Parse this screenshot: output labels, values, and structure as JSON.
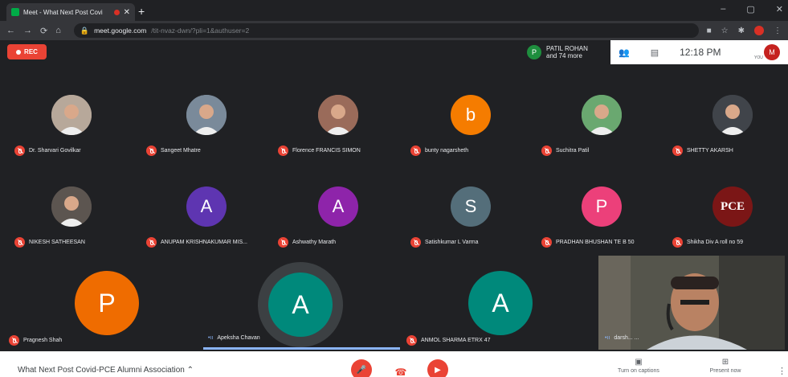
{
  "browser": {
    "tab_title": "Meet - What Next Post Covi",
    "url_host": "meet.google.com",
    "url_rest": "/tit-nvaz-dwn/?pli=1&authuser=2"
  },
  "meet": {
    "rec_label": "REC",
    "participants_initial": "P",
    "participants_line1": "PATIL ROHAN",
    "participants_line2": "and 74 more",
    "time": "12:18 PM",
    "you_label": "YOU",
    "me_initial": "M",
    "meeting_name": "What Next Post Covid-PCE Alumni Association",
    "captions_label": "Turn on captions",
    "present_label": "Present now"
  },
  "tiles": [
    {
      "name": "Dr. Sharvari Govilkar",
      "initial": "",
      "color": "#b7a89a"
    },
    {
      "name": "Sangeet Mhatre",
      "initial": "",
      "color": "#7a8a9a"
    },
    {
      "name": "Florence FRANCIS SIMON",
      "initial": "",
      "color": "#9a6b5a"
    },
    {
      "name": "bunty nagarsheth",
      "initial": "b",
      "color": "#f57c00"
    },
    {
      "name": "Suchitra Patil",
      "initial": "",
      "color": "#6aa870"
    },
    {
      "name": "SHETTY AKARSH",
      "initial": "",
      "color": "#40444a"
    },
    {
      "name": "NIKESH SATHEESAN",
      "initial": "",
      "color": "#5c5550"
    },
    {
      "name": "ANUPAM KRISHNAKUMAR MIS...",
      "initial": "A",
      "color": "#5e35b1"
    },
    {
      "name": "Ashwathy Marath",
      "initial": "A",
      "color": "#8e24aa"
    },
    {
      "name": "Satishkumar L Varma",
      "initial": "S",
      "color": "#546e7a"
    },
    {
      "name": "PRADHAN BHUSHAN TE B 50",
      "initial": "P",
      "color": "#ec407a"
    },
    {
      "name": "Shikha Div A roll no 59",
      "initial": "PCE",
      "color": "#7b1616"
    }
  ],
  "bottom": [
    {
      "name": "Pragnesh Shah",
      "initial": "P",
      "color": "#ef6c00"
    },
    {
      "name": "Apeksha Chavan",
      "initial": "A",
      "color": "#00897b"
    },
    {
      "name": "ANMOL SHARMA ETRX 47",
      "initial": "A",
      "color": "#00897b"
    },
    {
      "name": "darsh... ...",
      "initial": "",
      "color": "#4a4a44"
    }
  ]
}
